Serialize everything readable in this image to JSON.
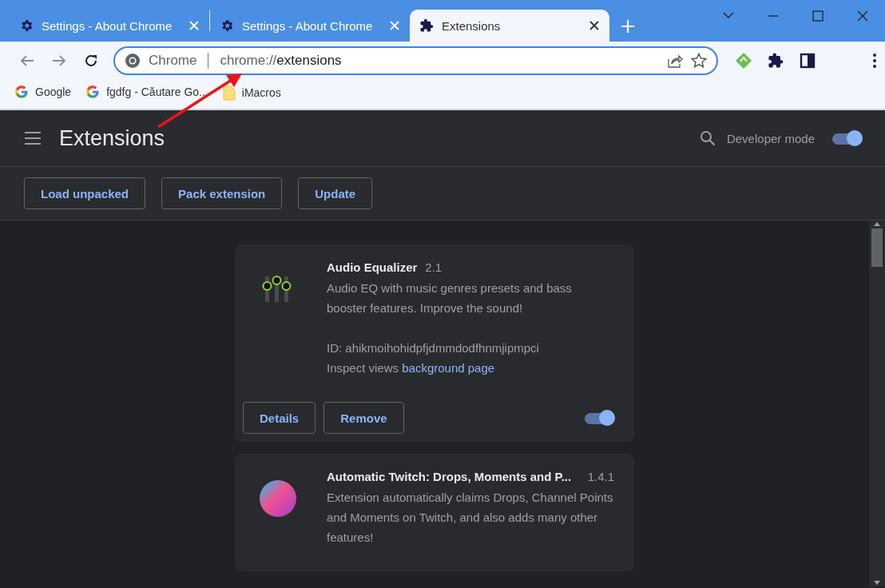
{
  "tabs": [
    {
      "title": "Settings - About Chrome",
      "kind": "settings",
      "selected": false
    },
    {
      "title": "Settings - About Chrome",
      "kind": "settings",
      "selected": false
    },
    {
      "title": "Extensions",
      "kind": "extensions",
      "selected": true
    }
  ],
  "address_bar": {
    "site_label": "Chrome",
    "url_scheme": "chrome://",
    "url_path": "extensions"
  },
  "bookmarks": [
    {
      "label": "Google",
      "kind": "google"
    },
    {
      "label": "fgdfg - Căutare Go...",
      "kind": "google"
    },
    {
      "label": "iMacros",
      "kind": "folder"
    }
  ],
  "header": {
    "title": "Extensions",
    "developer_mode": {
      "label": "Developer mode",
      "on": true
    }
  },
  "actions": [
    "Load unpacked",
    "Pack extension",
    "Update"
  ],
  "extensions": [
    {
      "kind": "equalizer",
      "name": "Audio Equalizer",
      "version": "2.1",
      "description": "Audio EQ with music genres presets and bass booster features. Improve the sound!",
      "id_text": "ID: ahikmoihohidpfjdmmdodfhnmjipmpci",
      "inspect_label": "Inspect views",
      "inspect_link": "background page",
      "buttons": [
        "Details",
        "Remove"
      ],
      "enabled": true
    },
    {
      "kind": "orb",
      "name": "Automatic Twitch: Drops, Moments and P...",
      "version": "1.4.1",
      "description": "Extension automatically claims Drops, Channel Points and Moments on Twitch, and also adds many other features!"
    }
  ]
}
